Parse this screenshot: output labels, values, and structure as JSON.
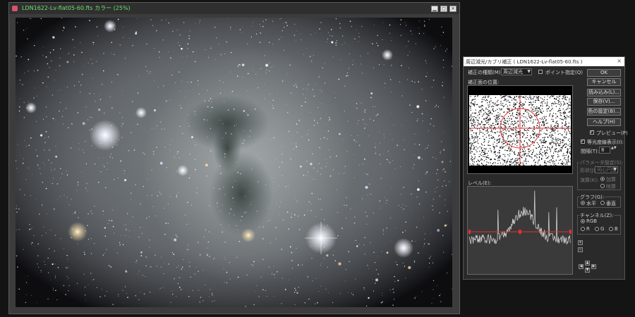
{
  "image_window": {
    "title": "LDN1622-Lv-flat05-60.fts カラー (25%)",
    "icon": "app-icon",
    "minimize_glyph": "▁",
    "maximize_glyph": "◻",
    "close_glyph": "×"
  },
  "dialog": {
    "title": "周辺減光/カブリ補正 ( LDN1622-Lv-flat05-60.fts )",
    "close_glyph": "×",
    "correction_type_label": "補正の種類(M):",
    "correction_type_value": "周辺減光",
    "point_label": "ポイント指定(Q)",
    "preview_area_label": "補正面の位置:",
    "level_label": "レベル(E):",
    "buttons": {
      "ok": "OK",
      "cancel": "キャンセル",
      "load": "読み込み(L)...",
      "save": "保存(V)...",
      "color_settings": "色の設定(B)...",
      "help": "ヘルプ(H)"
    },
    "preview_checkbox": "プレビュー(P)",
    "isoline_checkbox": "等光度線表示(I):",
    "interval_label": "間隔(T):",
    "interval_value": "8",
    "parameter_group_label": "パラメータ設定(S):",
    "shape_label": "形状(J):",
    "shape_value": "同心円型",
    "method_label": "演算(K):",
    "method_options": [
      "加算",
      "除算"
    ],
    "graph_group_label": "グラフ(G):",
    "graph_options": [
      "水平",
      "垂直"
    ],
    "channel_group_label": "チャンネル(Z):",
    "channel_rgb": "RGB",
    "channel_options": [
      "R",
      "G",
      "B"
    ],
    "zoom_in": "+",
    "zoom_out": "−",
    "nav_left": "◀",
    "nav_up": "▲",
    "nav_down": "▼",
    "nav_right": "▶",
    "spin_glyph": "▲▼",
    "dropdown_glyph": "▼"
  }
}
